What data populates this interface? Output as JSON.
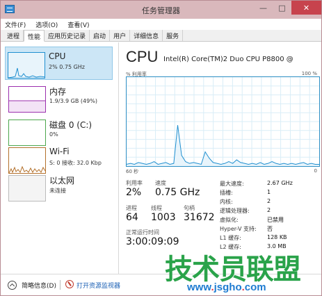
{
  "window": {
    "title": "任务管理器",
    "minimize_glyph": "—",
    "maximize_glyph": "□",
    "close_glyph": "✕"
  },
  "menu": [
    "文件(F)",
    "选项(O)",
    "查看(V)"
  ],
  "tabs": [
    {
      "label": "进程",
      "active": false
    },
    {
      "label": "性能",
      "active": true
    },
    {
      "label": "应用历史记录",
      "active": false
    },
    {
      "label": "启动",
      "active": false
    },
    {
      "label": "用户",
      "active": false
    },
    {
      "label": "详细信息",
      "active": false
    },
    {
      "label": "服务",
      "active": false
    }
  ],
  "sidebar": {
    "items": [
      {
        "title": "CPU",
        "sub": "2% 0.75 GHz",
        "selected": true,
        "color": "#1f8fd0"
      },
      {
        "title": "内存",
        "sub": "1.9/3.9 GB (49%)",
        "selected": false,
        "color": "#9b2fae"
      },
      {
        "title": "磁盘 0 (C:)",
        "sub": "0%",
        "selected": false,
        "color": "#4ca64c"
      },
      {
        "title": "Wi-Fi",
        "sub": "S: 0 接收: 32.0 Kbp",
        "selected": false,
        "color": "#b3702b"
      },
      {
        "title": "以太网",
        "sub": "未连接",
        "selected": false,
        "color": "#999999"
      }
    ]
  },
  "main": {
    "title": "CPU",
    "model": "Intel(R) Core(TM)2 Duo CPU P8800 @",
    "axis_top_left": "% 利用率",
    "axis_top_right": "100 %",
    "axis_bottom_left": "60 秒",
    "axis_bottom_right": "0",
    "stats": {
      "utilization_label": "利用率",
      "utilization_value": "2%",
      "speed_label": "速度",
      "speed_value": "0.75 GHz",
      "processes_label": "进程",
      "processes_value": "64",
      "threads_label": "线程",
      "threads_value": "1003",
      "handles_label": "句柄",
      "handles_value": "31672",
      "uptime_label": "正常运行时间",
      "uptime_value": "3:00:09:09"
    },
    "specs": [
      {
        "label": "最大速度:",
        "value": "2.67 GHz"
      },
      {
        "label": "插槽:",
        "value": "1"
      },
      {
        "label": "内核:",
        "value": "2"
      },
      {
        "label": "逻辑处理器:",
        "value": "2"
      },
      {
        "label": "虚拟化:",
        "value": "已禁用"
      },
      {
        "label": "Hyper-V 支持:",
        "value": "否"
      },
      {
        "label": "L1 缓存:",
        "value": "128 KB"
      },
      {
        "label": "L2 缓存:",
        "value": "3.0 MB"
      }
    ]
  },
  "footer": {
    "less_details": "简略信息(D)",
    "open_monitor": "打开资源监视器"
  },
  "watermark": {
    "big": "技术员联盟",
    "url_prefix": "www",
    "url_mid": "jsgho",
    "url_suffix": "com"
  },
  "chart_data": {
    "type": "line",
    "title": "% 利用率",
    "x_range_seconds": [
      60,
      0
    ],
    "ylim": [
      0,
      100
    ],
    "series": [
      {
        "values": [
          2,
          3,
          2,
          4,
          3,
          2,
          3,
          5,
          2,
          3,
          4,
          2,
          3,
          46,
          12,
          5,
          3,
          4,
          3,
          2,
          16,
          9,
          4,
          3,
          2,
          3,
          5,
          3,
          7,
          4,
          3,
          2,
          3,
          2,
          4,
          2,
          3,
          5,
          3,
          2,
          3,
          2,
          3,
          2,
          3,
          4,
          2,
          3,
          2,
          2
        ]
      }
    ]
  }
}
